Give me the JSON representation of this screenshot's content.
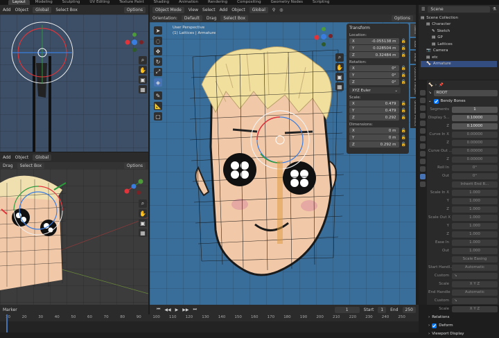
{
  "workspace_tabs": [
    "Layout",
    "Modeling",
    "Sculpting",
    "UV Editing",
    "Texture Paint",
    "Shading",
    "Animation",
    "Rendering",
    "Compositing",
    "Geometry Nodes",
    "Scripting"
  ],
  "top_left_header": {
    "items": [
      "Add",
      "Object"
    ],
    "global": "Global",
    "select_box": "Select Box",
    "options": "Options"
  },
  "bottom_left_header": {
    "items": [
      "Add",
      "Object"
    ],
    "global": "Global",
    "drag": "Drag",
    "select_box": "Select Box",
    "options": "Options"
  },
  "main_header": {
    "mode": "Object Mode",
    "menus": [
      "View",
      "Select",
      "Add",
      "Object"
    ],
    "global": "Global",
    "orientation_label": "Orientation:",
    "orientation_value": "Default",
    "drag": "Drag",
    "select_box": "Select Box",
    "options": "Options"
  },
  "viewport": {
    "line1": "User Perspective",
    "line2": "(1) Lattices | Armature"
  },
  "transform": {
    "title": "Transform",
    "location_label": "Location:",
    "location": [
      {
        "axis": "X",
        "value": "-0.055138 m"
      },
      {
        "axis": "Y",
        "value": "0.028504 m"
      },
      {
        "axis": "Z",
        "value": "0.32484 m"
      }
    ],
    "rotation_label": "Rotation:",
    "rotation": [
      {
        "axis": "X",
        "value": "0°"
      },
      {
        "axis": "Y",
        "value": "0°"
      },
      {
        "axis": "Z",
        "value": "0°"
      }
    ],
    "rotation_mode": "XYZ Euler",
    "scale_label": "Scale:",
    "scale": [
      {
        "axis": "X",
        "value": "0.479"
      },
      {
        "axis": "Y",
        "value": "0.479"
      },
      {
        "axis": "Z",
        "value": "0.292"
      }
    ],
    "dimensions_label": "Dimensions:",
    "dimensions": [
      {
        "axis": "X",
        "value": "0 m"
      },
      {
        "axis": "Y",
        "value": "0 m"
      },
      {
        "axis": "Z",
        "value": "0.292 m"
      }
    ]
  },
  "npanel_tabs": [
    "Item",
    "Tool",
    "View",
    "Outline Helper",
    "Grease Pencil"
  ],
  "outliner": {
    "search_title": "Scene",
    "rows": [
      {
        "label": "Scene Collection",
        "indent": 0,
        "icon": "collection-icon"
      },
      {
        "label": "Character",
        "indent": 1,
        "icon": "collection-icon"
      },
      {
        "label": "Sketch",
        "indent": 2,
        "icon": "grease-pencil-icon"
      },
      {
        "label": "GP",
        "indent": 2,
        "icon": "collection-icon"
      },
      {
        "label": "Lattices",
        "indent": 2,
        "icon": "collection-icon"
      },
      {
        "label": "Camera",
        "indent": 1,
        "icon": "camera-icon"
      },
      {
        "label": "etc",
        "indent": 1,
        "icon": "collection-icon"
      },
      {
        "label": "Armature",
        "indent": 1,
        "icon": "armature-icon"
      }
    ]
  },
  "properties": {
    "bone_name": "ROOT",
    "section": "Bendy Bones",
    "rows": [
      {
        "k": "Segments",
        "v": "1",
        "hi": true
      },
      {
        "k": "Display S...",
        "v": "0.10000",
        "hi": true
      },
      {
        "k": "Z",
        "v": "0.10000",
        "hi": true
      },
      {
        "k": "Curve In X",
        "v": "0.00000",
        "hi": false
      },
      {
        "k": "Z",
        "v": "0.00000",
        "hi": false
      },
      {
        "k": "Curve Out ...",
        "v": "0.00000",
        "hi": false
      },
      {
        "k": "Z",
        "v": "0.00000",
        "hi": false
      },
      {
        "k": "Roll In",
        "v": "0°",
        "hi": false
      },
      {
        "k": "Out",
        "v": "0°",
        "hi": false
      },
      {
        "k": "",
        "v": "Inherit End R...",
        "hi": false
      },
      {
        "k": "Scale In X",
        "v": "1.000",
        "hi": false
      },
      {
        "k": "Y",
        "v": "1.000",
        "hi": false
      },
      {
        "k": "Z",
        "v": "1.000",
        "hi": false
      },
      {
        "k": "Scale Out X",
        "v": "1.000",
        "hi": false
      },
      {
        "k": "Y",
        "v": "1.000",
        "hi": false
      },
      {
        "k": "Z",
        "v": "1.000",
        "hi": false
      },
      {
        "k": "Ease In",
        "v": "1.000",
        "hi": false
      },
      {
        "k": "Out",
        "v": "1.000",
        "hi": false
      },
      {
        "k": "",
        "v": "Scale Easing",
        "hi": false
      }
    ],
    "start_handle_label": "Start Handl...",
    "start_handle_value": "Automatic",
    "start_custom": "Custom",
    "start_scale": "Scale",
    "end_handle_label": "End Handle",
    "end_handle_value": "Automatic",
    "end_custom": "Custom",
    "end_scale": "Scale",
    "xyz": "X  Y  Z",
    "relations": "Relations",
    "deform": "Deform",
    "viewport_display": "Viewport Display"
  },
  "timeline": {
    "current_frame": "1",
    "start_label": "Start",
    "start": "1",
    "end_label": "End",
    "end": "250",
    "ticks": [
      "10",
      "20",
      "30",
      "40",
      "50",
      "60",
      "70",
      "80",
      "90",
      "100",
      "110",
      "120",
      "130",
      "140",
      "150",
      "160",
      "170",
      "180",
      "190",
      "200",
      "210",
      "220",
      "230",
      "240",
      "250"
    ],
    "marker_label": "Marker"
  },
  "colors": {
    "accent": "#4772b3",
    "viewport_bg": "#3d4f66",
    "skin": "#f2c9a8"
  }
}
